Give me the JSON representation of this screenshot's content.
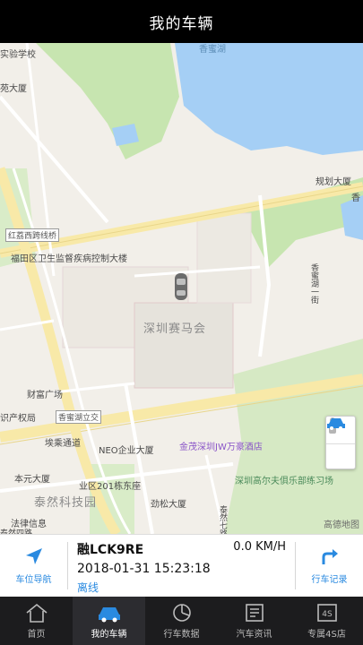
{
  "header": {
    "title": "我的车辆"
  },
  "map": {
    "labels": {
      "school": "实验学校",
      "building_yuan": "苑大厦",
      "lake": "香蜜湖",
      "guihua": "规划大厦",
      "xiang": "香",
      "honglizi": "红荔西跨线桥",
      "cdc": "福田区卫生监督疾病控制大楼",
      "xiangmi_rd": "香蜜湖一街",
      "racecourse": "深圳赛马会",
      "caifu": "财富广场",
      "zhichan": "识产权局",
      "xiangmi_bridge": "香蜜湖立交",
      "neo": "NEO企业大厦",
      "jinmao": "金茂深圳JW万豪酒店",
      "caitong": "埃乘通道",
      "benyuan": "本元大厦",
      "yeqv": "业区201栋东座",
      "golf": "深圳高尔夫俱乐部练习场",
      "taikang": "泰然科技园",
      "jinsong": "劲松大厦",
      "falv": "法律信息",
      "taijian": "泰然四路",
      "taiqi": "泰然七路",
      "gaode": "高德地图"
    },
    "accent_blue": "#2a8ae0",
    "water": "#a5cff5",
    "green": "#c7e5b0"
  },
  "vehicle": {
    "plate": "融LCK9RE",
    "speed": "0.0 KM/H",
    "timestamp": "2018-01-31 15:23:18",
    "status": "离线"
  },
  "actions": {
    "nav_label": "车位导航",
    "trip_label": "行车记录"
  },
  "tabs": [
    {
      "label": "首页",
      "icon": "home-icon"
    },
    {
      "label": "我的车辆",
      "icon": "car-icon"
    },
    {
      "label": "行车数据",
      "icon": "pie-chart-icon"
    },
    {
      "label": "汽车资讯",
      "icon": "news-icon"
    },
    {
      "label": "专属4S店",
      "icon": "4s-store-icon"
    }
  ]
}
